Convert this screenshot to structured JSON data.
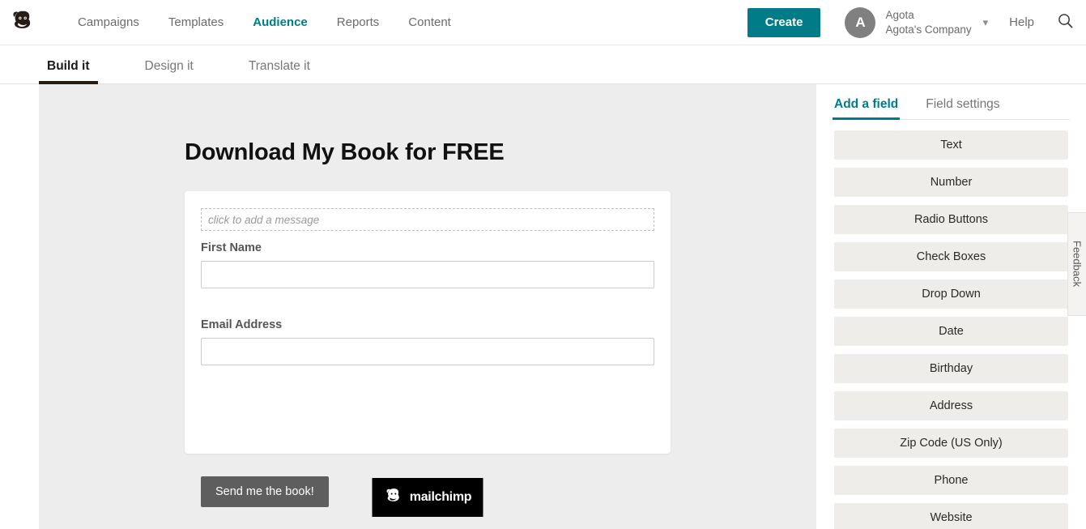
{
  "header": {
    "logo_icon": "mailchimp-monkey-logo",
    "nav": [
      {
        "label": "Campaigns",
        "active": false
      },
      {
        "label": "Templates",
        "active": false
      },
      {
        "label": "Audience",
        "active": true
      },
      {
        "label": "Reports",
        "active": false
      },
      {
        "label": "Content",
        "active": false
      }
    ],
    "create_label": "Create",
    "avatar_initial": "A",
    "account_name": "Agota",
    "account_company": "Agota's Company",
    "chevron_icon": "chevron-down-icon",
    "help_label": "Help",
    "search_icon": "search-icon",
    "accent_color": "#007c89"
  },
  "subtabs": [
    {
      "label": "Build it",
      "active": true
    },
    {
      "label": "Design it",
      "active": false
    },
    {
      "label": "Translate it",
      "active": false
    }
  ],
  "preview": {
    "form_title": "Download My Book for FREE",
    "message_placeholder": "click to add a message",
    "fields": [
      {
        "label": "First Name",
        "value": ""
      },
      {
        "label": "Email Address",
        "value": ""
      }
    ],
    "submit_label": "Send me the book!",
    "badge_text": "mailchimp",
    "badge_icon": "mailchimp-monkey-logo",
    "background_color": "#ededed",
    "submit_color": "#5e5e5e"
  },
  "right_panel": {
    "tabs": [
      {
        "label": "Add a field",
        "active": true
      },
      {
        "label": "Field settings",
        "active": false
      }
    ],
    "field_types": [
      "Text",
      "Number",
      "Radio Buttons",
      "Check Boxes",
      "Drop Down",
      "Date",
      "Birthday",
      "Address",
      "Zip Code (US Only)",
      "Phone",
      "Website"
    ]
  },
  "feedback": {
    "label": "Feedback"
  }
}
